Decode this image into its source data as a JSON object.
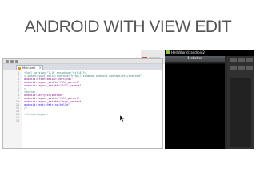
{
  "slide": {
    "title": "ANDROID WITH VIEW EDIT"
  },
  "editor": {
    "tab_label": "Main.xml",
    "line_numbers": [
      "1",
      "2",
      "3",
      "4",
      "5",
      "6",
      "7",
      "8",
      "9",
      "10",
      "11",
      "12",
      "13",
      "14",
      "15",
      "16"
    ],
    "code_lines": [
      "<?xml version=\"1.0\" encoding=\"utf-8\"?>",
      "<LinearLayout xmlns:android=\"http://schemas.android.com/apk/res/android\"",
      "    android:orientation=\"vertical\"",
      "    android:layout_width=\"fill_parent\"",
      "    android:layout_height=\"fill_parent\"",
      "    >",
      "<Button",
      "    android:id=\"@+id/button\"",
      "    android:layout_width=\"fill_parent\"",
      "    android:layout_height=\"wrap_content\"",
      "    android:text=\"@string/hello\"",
      "    />",
      "",
      "</LinearLayout>",
      "",
      ""
    ]
  },
  "emulator": {
    "status_title": "HelloWorld: android2",
    "title_bar": "1 sticker"
  },
  "colors": {
    "slide_title": "#555555",
    "device_bg": "#111111",
    "android_green": "#8fc43c"
  }
}
